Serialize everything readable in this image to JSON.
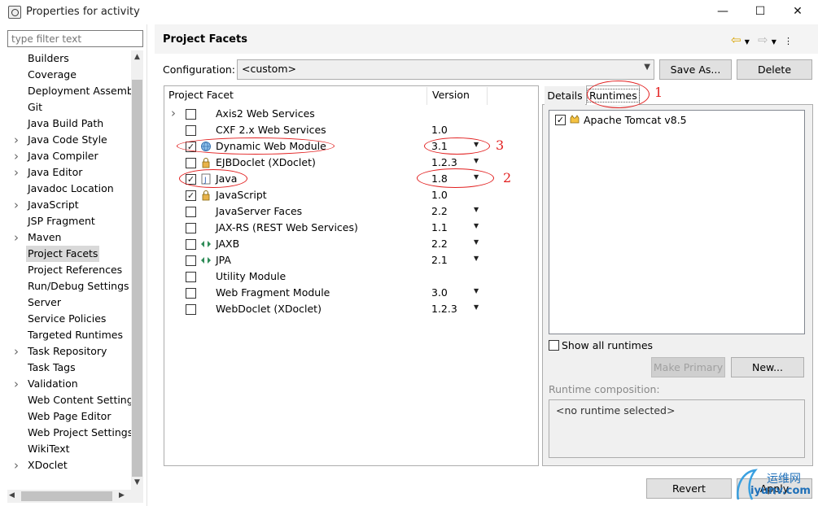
{
  "window": {
    "title": "Properties for activity",
    "minimize": "—",
    "maximize": "☐",
    "close": "✕"
  },
  "filter": {
    "placeholder": "type filter text"
  },
  "nav": {
    "items": [
      {
        "label": "Builders",
        "expandable": false
      },
      {
        "label": "Coverage",
        "expandable": false
      },
      {
        "label": "Deployment Assembly",
        "expandable": false
      },
      {
        "label": "Git",
        "expandable": false
      },
      {
        "label": "Java Build Path",
        "expandable": false
      },
      {
        "label": "Java Code Style",
        "expandable": true
      },
      {
        "label": "Java Compiler",
        "expandable": true
      },
      {
        "label": "Java Editor",
        "expandable": true
      },
      {
        "label": "Javadoc Location",
        "expandable": false
      },
      {
        "label": "JavaScript",
        "expandable": true
      },
      {
        "label": "JSP Fragment",
        "expandable": false
      },
      {
        "label": "Maven",
        "expandable": true
      },
      {
        "label": "Project Facets",
        "expandable": false,
        "selected": true
      },
      {
        "label": "Project References",
        "expandable": false
      },
      {
        "label": "Run/Debug Settings",
        "expandable": false
      },
      {
        "label": "Server",
        "expandable": false
      },
      {
        "label": "Service Policies",
        "expandable": false
      },
      {
        "label": "Targeted Runtimes",
        "expandable": false
      },
      {
        "label": "Task Repository",
        "expandable": true
      },
      {
        "label": "Task Tags",
        "expandable": false
      },
      {
        "label": "Validation",
        "expandable": true
      },
      {
        "label": "Web Content Settings",
        "expandable": false
      },
      {
        "label": "Web Page Editor",
        "expandable": false
      },
      {
        "label": "Web Project Settings",
        "expandable": false
      },
      {
        "label": "WikiText",
        "expandable": false
      },
      {
        "label": "XDoclet",
        "expandable": true
      }
    ]
  },
  "page": {
    "title": "Project Facets",
    "configuration_label": "Configuration:",
    "configuration_value": "<custom>",
    "save_as": "Save As...",
    "delete": "Delete"
  },
  "table": {
    "col_facet": "Project Facet",
    "col_version": "Version",
    "rows": [
      {
        "name": "Axis2 Web Services",
        "version": "",
        "checked": false,
        "expandable": true,
        "icon": "none",
        "dropdown": false
      },
      {
        "name": "CXF 2.x Web Services",
        "version": "1.0",
        "checked": false,
        "expandable": false,
        "icon": "none",
        "dropdown": false
      },
      {
        "name": "Dynamic Web Module",
        "version": "3.1",
        "checked": true,
        "expandable": false,
        "icon": "globe-icon",
        "dropdown": true
      },
      {
        "name": "EJBDoclet (XDoclet)",
        "version": "1.2.3",
        "checked": false,
        "expandable": false,
        "icon": "lock-icon",
        "dropdown": true
      },
      {
        "name": "Java",
        "version": "1.8",
        "checked": true,
        "expandable": false,
        "icon": "java-file-icon",
        "dropdown": true
      },
      {
        "name": "JavaScript",
        "version": "1.0",
        "checked": true,
        "expandable": false,
        "icon": "lock-icon",
        "dropdown": false
      },
      {
        "name": "JavaServer Faces",
        "version": "2.2",
        "checked": false,
        "expandable": false,
        "icon": "none",
        "dropdown": true
      },
      {
        "name": "JAX-RS (REST Web Services)",
        "version": "1.1",
        "checked": false,
        "expandable": false,
        "icon": "none",
        "dropdown": true
      },
      {
        "name": "JAXB",
        "version": "2.2",
        "checked": false,
        "expandable": false,
        "icon": "arrows-icon",
        "dropdown": true
      },
      {
        "name": "JPA",
        "version": "2.1",
        "checked": false,
        "expandable": false,
        "icon": "arrows-icon",
        "dropdown": true
      },
      {
        "name": "Utility Module",
        "version": "",
        "checked": false,
        "expandable": false,
        "icon": "none",
        "dropdown": false
      },
      {
        "name": "Web Fragment Module",
        "version": "3.0",
        "checked": false,
        "expandable": false,
        "icon": "none",
        "dropdown": true
      },
      {
        "name": "WebDoclet (XDoclet)",
        "version": "1.2.3",
        "checked": false,
        "expandable": false,
        "icon": "none",
        "dropdown": true
      }
    ]
  },
  "tabs": {
    "details": "Details",
    "runtimes": "Runtimes"
  },
  "runtimes": {
    "items": [
      {
        "label": "Apache Tomcat v8.5",
        "checked": true
      }
    ],
    "show_all": "Show all runtimes",
    "make_primary": "Make Primary",
    "new": "New...",
    "composition_label": "Runtime composition:",
    "composition_value": "<no runtime selected>"
  },
  "footer": {
    "revert": "Revert",
    "apply": "Apply"
  },
  "annotations": {
    "one": "1",
    "two": "2",
    "three": "3",
    "color": "#e21f1f"
  },
  "watermark": {
    "line1": "运维网",
    "line2": "iyunv.com"
  }
}
